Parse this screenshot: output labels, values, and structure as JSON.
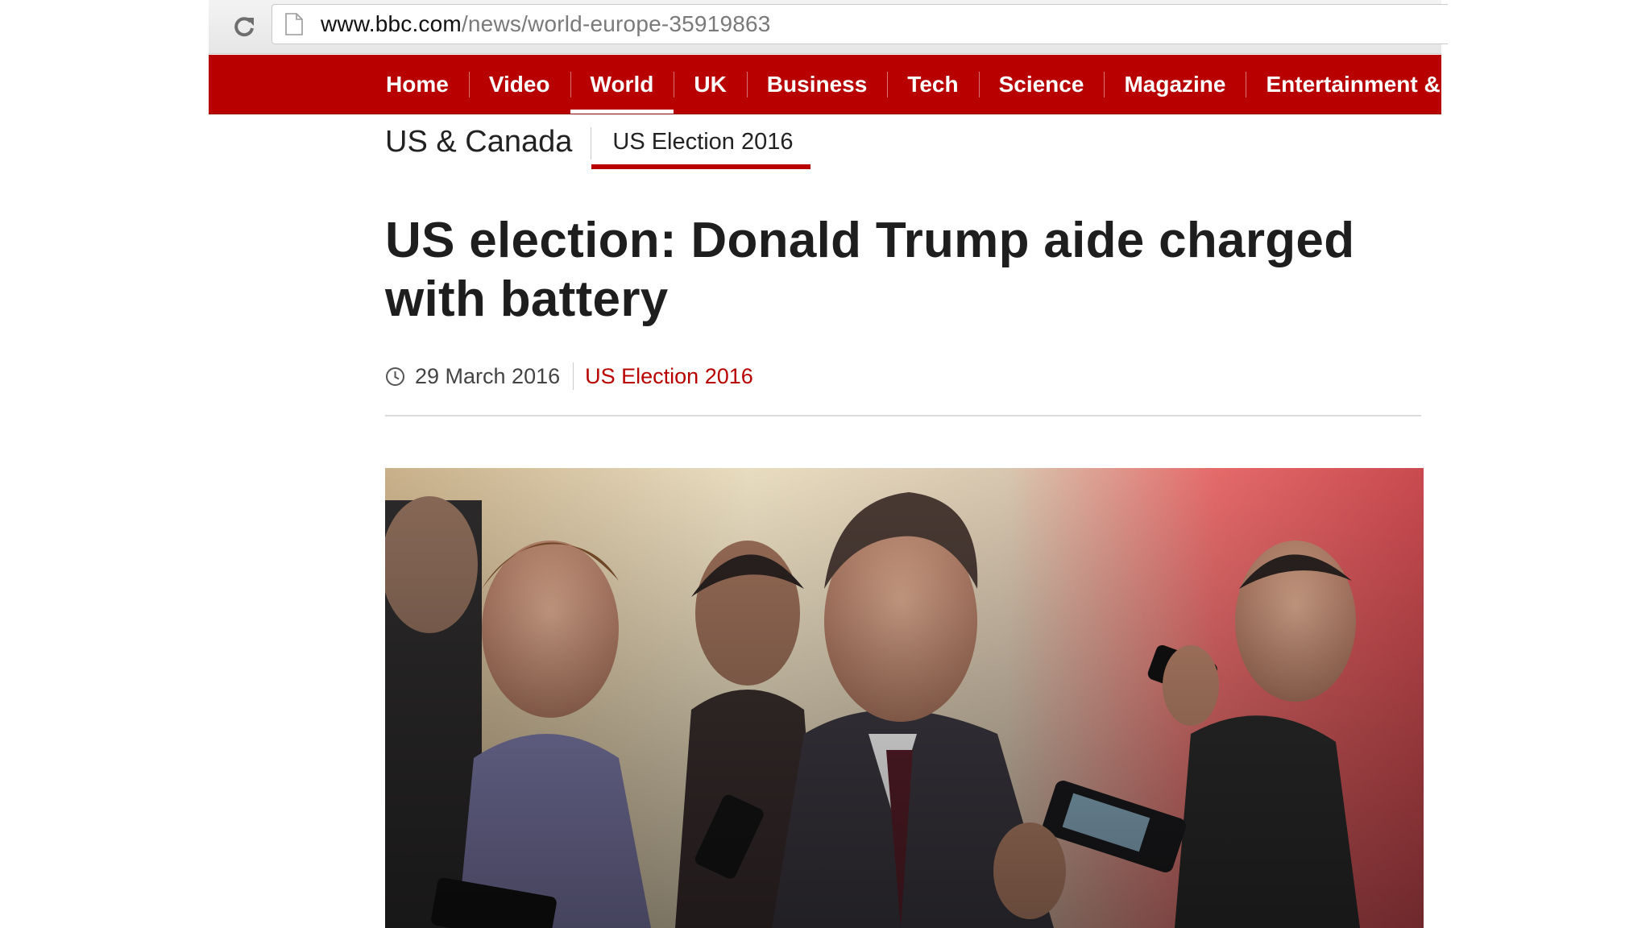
{
  "browser": {
    "url_host": "www.bbc.com",
    "url_path": "/news/world-europe-35919863"
  },
  "nav": {
    "items": [
      {
        "label": "Home"
      },
      {
        "label": "Video"
      },
      {
        "label": "World",
        "active": true
      },
      {
        "label": "UK"
      },
      {
        "label": "Business"
      },
      {
        "label": "Tech"
      },
      {
        "label": "Science"
      },
      {
        "label": "Magazine"
      },
      {
        "label": "Entertainment & Arts"
      }
    ]
  },
  "subnav": {
    "section": "US & Canada",
    "active_item": "US Election 2016"
  },
  "article": {
    "headline": "US election: Donald Trump aide charged with battery",
    "date": "29 March 2016",
    "tag": "US Election 2016"
  },
  "colors": {
    "bbc_red": "#b80000",
    "link_red": "#b80000"
  }
}
